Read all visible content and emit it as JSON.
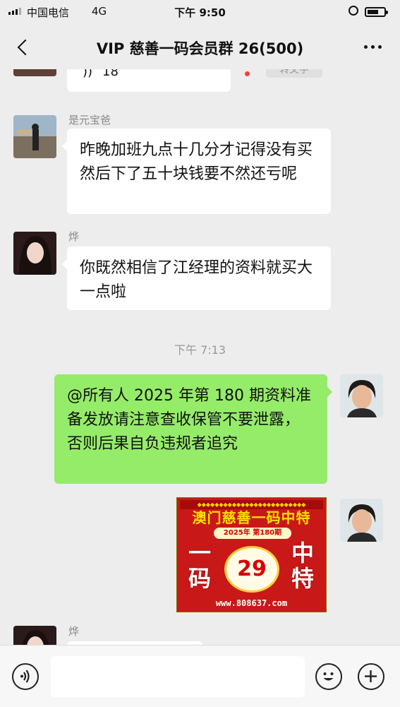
{
  "status_bar": {
    "carrier": "中国电信",
    "network": "4G",
    "time": "下午 9:50"
  },
  "nav": {
    "title": "VIP 慈善一码会员群 26(500)",
    "back_icon": "chevron-left-icon",
    "more_icon": "ellipsis-icon"
  },
  "chat": {
    "partial_top": {
      "voice_text": "18"
    },
    "messages": [
      {
        "sender": "是元宝爸",
        "text": "昨晚加班九点十几分才记得没有买然后下了五十块钱要不然还亏呢"
      },
      {
        "sender": "烨",
        "text": "你既然相信了江经理的资料就买大一点啦"
      }
    ],
    "timestamp": "下午 7:13",
    "own_message": {
      "text": "@所有人 2025 年第 180 期资料准备发放请注意查收保管不要泄露，否则后果自负违规者追究"
    },
    "poster": {
      "title": "澳门慈善一码中特",
      "period": "2025年 第180期",
      "number": "29",
      "left_text_1": "一",
      "left_text_2": "码",
      "right_text_1": "中",
      "right_text_2": "特",
      "url": "www.808637.com"
    },
    "partial_bottom": {
      "sender": "烨"
    }
  },
  "input_bar": {
    "voice_icon": "voice-icon",
    "emoji_icon": "emoji-icon",
    "plus_icon": "plus-icon"
  },
  "colors": {
    "background": "#ededed",
    "own_bubble": "#95ec69",
    "other_bubble": "#ffffff",
    "poster_red": "#c91818"
  }
}
